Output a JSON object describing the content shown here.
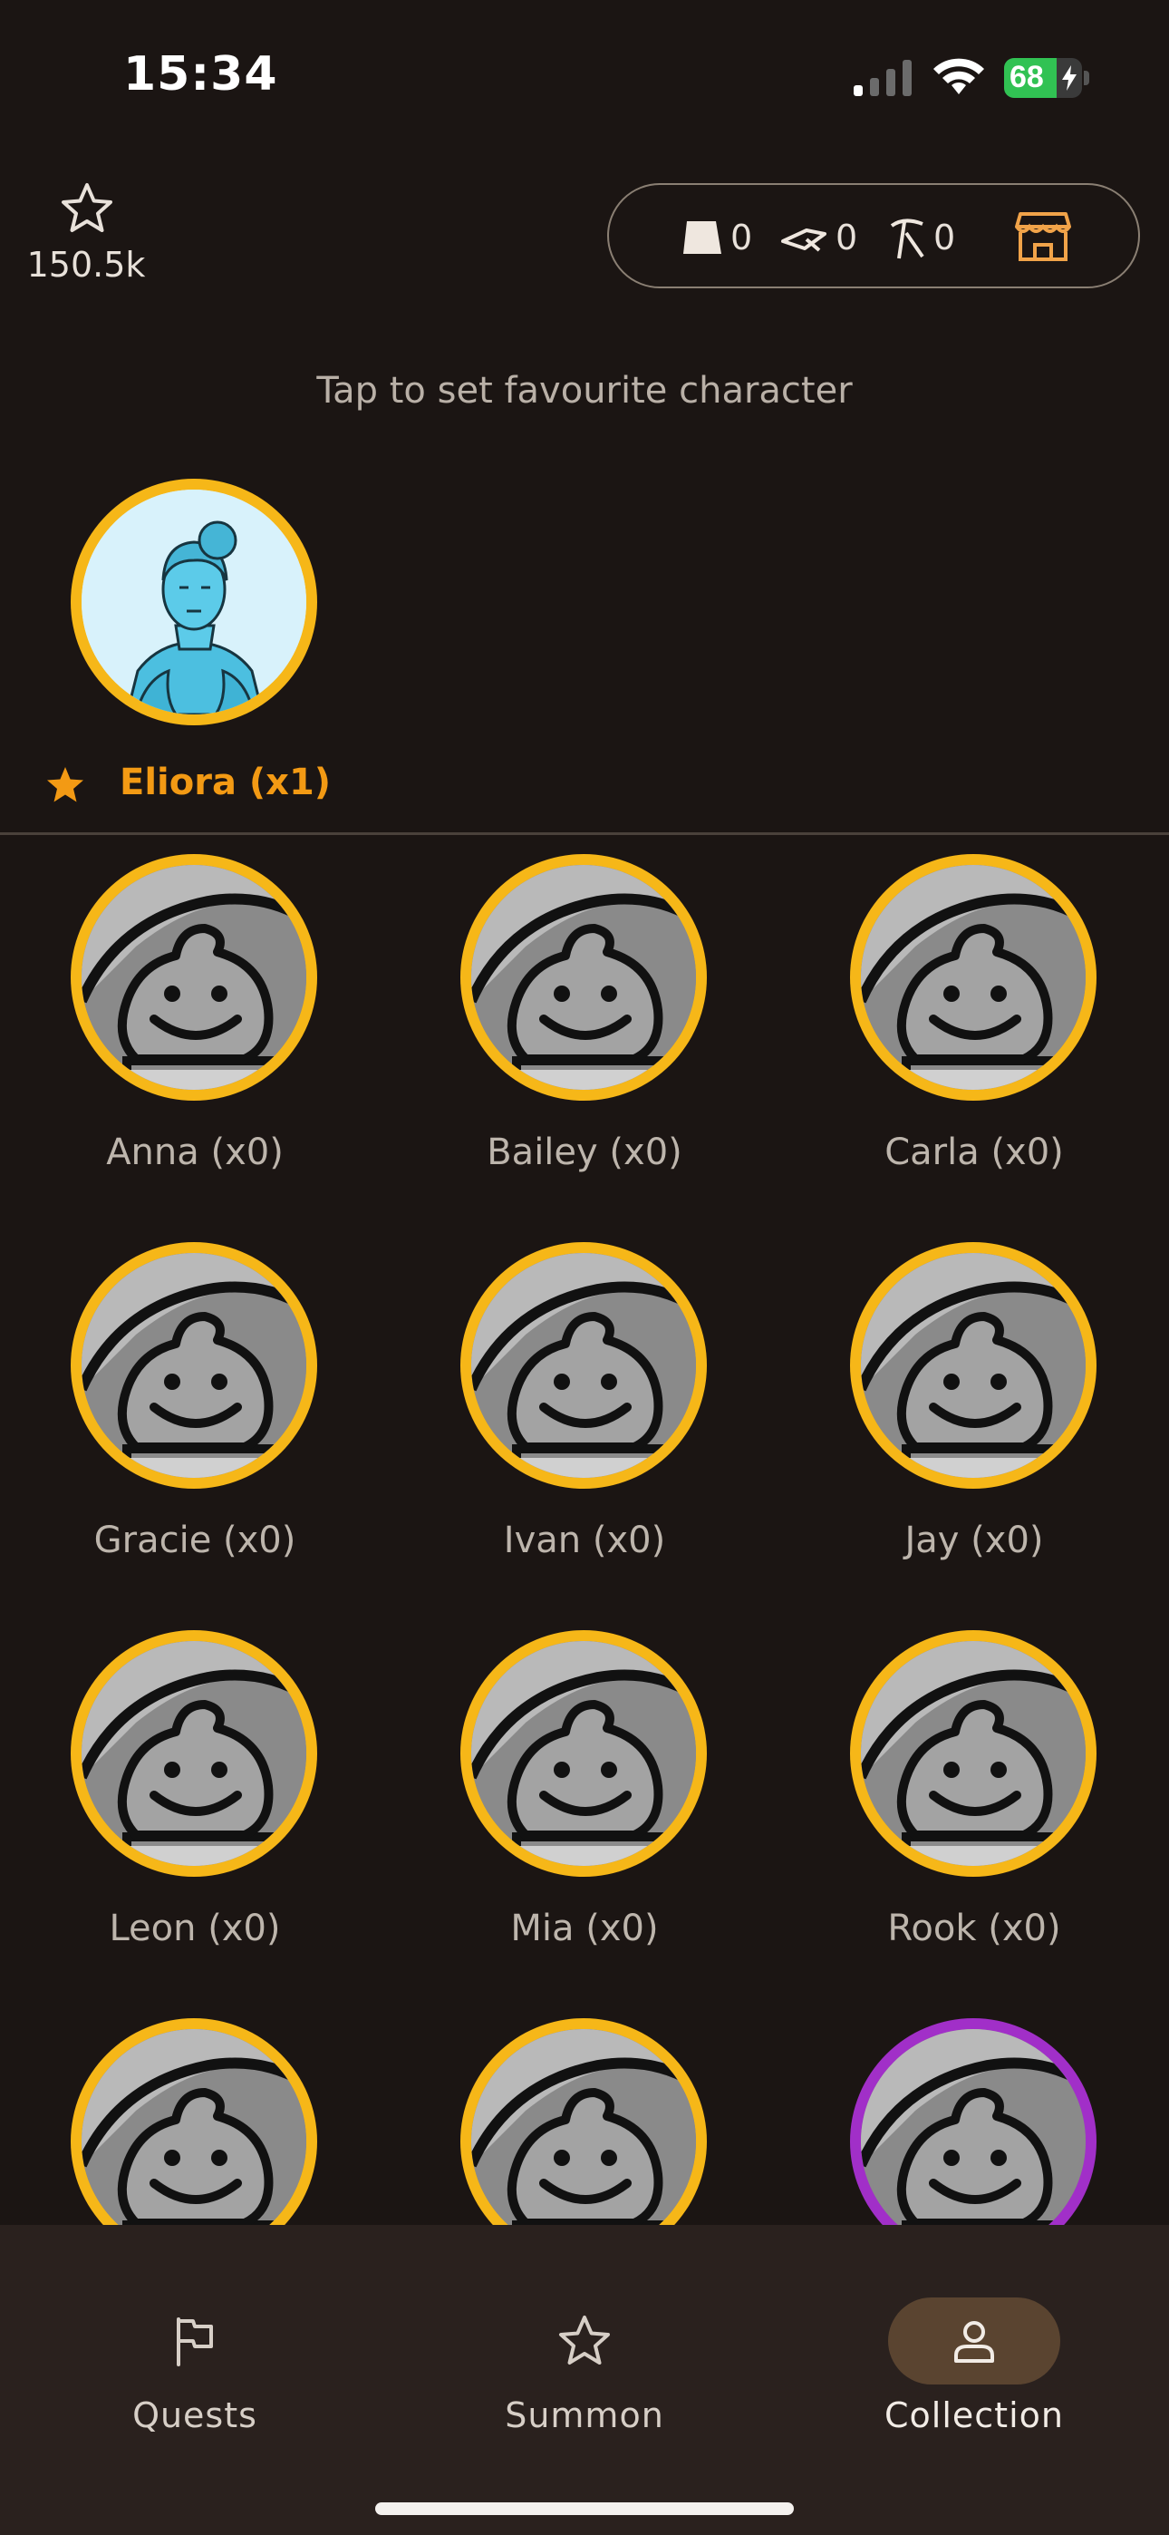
{
  "status_bar": {
    "time": "15:34",
    "battery_percent": 68,
    "battery_text": "68"
  },
  "header": {
    "points": "150.5k",
    "resources": [
      {
        "icon": "scroll-icon",
        "count": "0"
      },
      {
        "icon": "feather-icon",
        "count": "0"
      },
      {
        "icon": "pickaxe-icon",
        "count": "0"
      }
    ],
    "store_icon": "store-icon"
  },
  "hint": "Tap to set favourite character",
  "favourite": {
    "name": "Eliora (x1)"
  },
  "characters": [
    {
      "name": "Anna (x0)",
      "rarity": "gold"
    },
    {
      "name": "Bailey (x0)",
      "rarity": "gold"
    },
    {
      "name": "Carla (x0)",
      "rarity": "gold"
    },
    {
      "name": "Gracie (x0)",
      "rarity": "gold"
    },
    {
      "name": "Ivan (x0)",
      "rarity": "gold"
    },
    {
      "name": "Jay (x0)",
      "rarity": "gold"
    },
    {
      "name": "Leon (x0)",
      "rarity": "gold"
    },
    {
      "name": "Mia (x0)",
      "rarity": "gold"
    },
    {
      "name": "Rook (x0)",
      "rarity": "gold"
    },
    {
      "name": "",
      "rarity": "gold"
    },
    {
      "name": "",
      "rarity": "gold"
    },
    {
      "name": "",
      "rarity": "purple"
    }
  ],
  "nav": {
    "items": [
      {
        "label": "Quests",
        "icon": "flag-icon",
        "active": false
      },
      {
        "label": "Summon",
        "icon": "star-icon",
        "active": false
      },
      {
        "label": "Collection",
        "icon": "person-icon",
        "active": true
      }
    ]
  },
  "colors": {
    "gold": "#f6b718",
    "purple": "#a12fc8",
    "accent": "#f39a14",
    "background": "#1b1513"
  }
}
